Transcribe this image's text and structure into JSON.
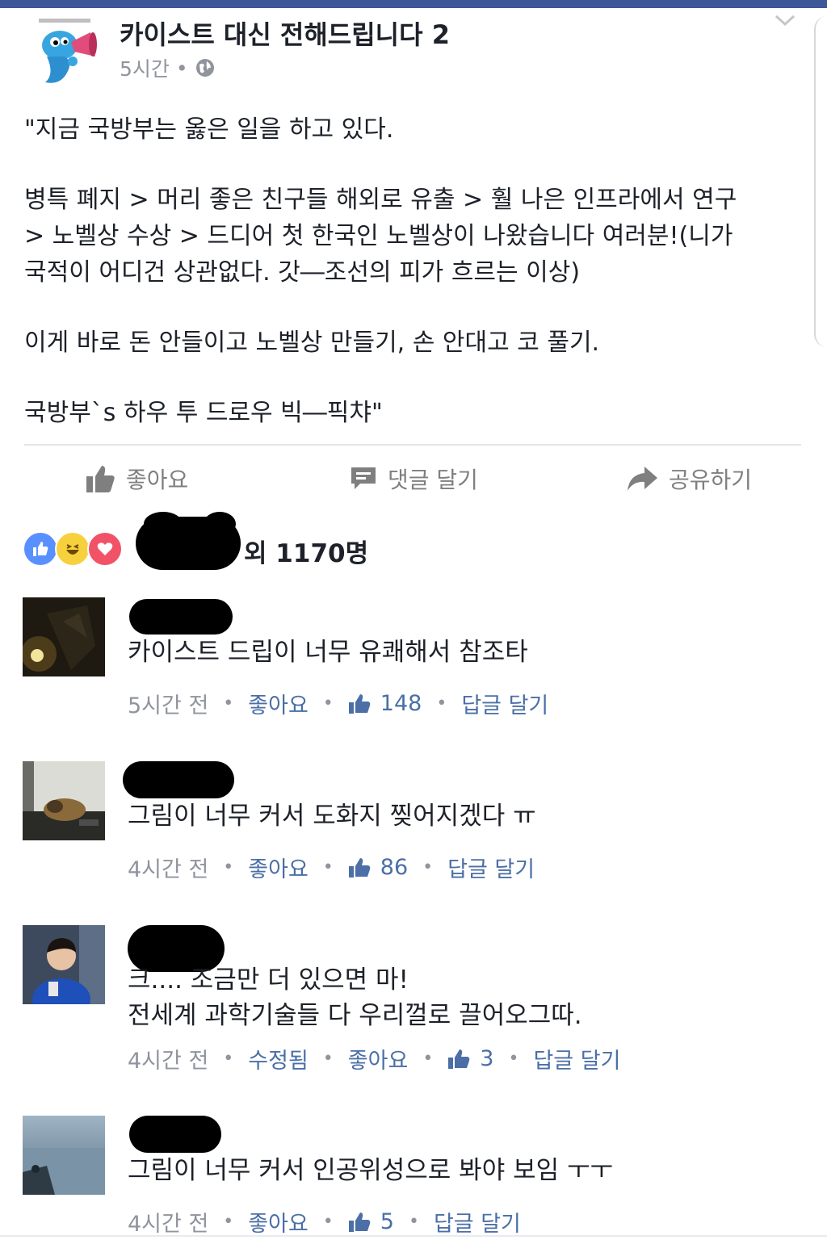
{
  "colors": {
    "brand": "#3b5998",
    "link": "#4b6fa6",
    "meta": "#90949c",
    "text": "#1d2129"
  },
  "post": {
    "page_name": "카이스트 대신 전해드립니다 2",
    "time": "5시간",
    "privacy_icon": "globe-icon",
    "body": [
      "\"지금 국방부는 옳은 일을 하고 있다.",
      "",
      "병특 폐지 > 머리 좋은 친구들 해외로 유출 > 훨 나은 인프라에서 연구",
      "> 노벨상 수상 > 드디어 첫 한국인 노벨상이 나왔습니다 여러분!(니가",
      "국적이 어디건 상관없다. 갓―조선의 피가 흐르는 이상)",
      "",
      "이게 바로 돈 안들이고 노벨상 만들기, 손 안대고 코 풀기.",
      "",
      "국방부`s 하우 투 드로우 빅―픽챠\""
    ]
  },
  "actions": {
    "like": "좋아요",
    "comment": "댓글 달기",
    "share": "공유하기"
  },
  "reactions": {
    "icons": [
      "like-icon",
      "haha-icon",
      "love-icon"
    ],
    "count_text": "외 1170명"
  },
  "comments": [
    {
      "lines": [
        "카이스트 드립이 너무 유쾌해서 참조타"
      ],
      "time": "5시간 전",
      "edited": "",
      "like": "좋아요",
      "likes": "148",
      "reply": "답글 달기"
    },
    {
      "lines": [
        "그림이 너무 커서 도화지 찢어지겠다 ㅠ"
      ],
      "time": "4시간 전",
      "edited": "",
      "like": "좋아요",
      "likes": "86",
      "reply": "답글 달기"
    },
    {
      "lines": [
        "크.... 조금만 더 있으면 마!",
        "전세계 과학기술들 다 우리껄로 끌어오그따."
      ],
      "time": "4시간 전",
      "edited": "수정됨",
      "like": "좋아요",
      "likes": "3",
      "reply": "답글 달기"
    },
    {
      "lines": [
        "그림이 너무 커서 인공위성으로 봐야 보임 ㅜㅜ"
      ],
      "time": "4시간 전",
      "edited": "",
      "like": "좋아요",
      "likes": "5",
      "reply": "답글 달기"
    }
  ]
}
